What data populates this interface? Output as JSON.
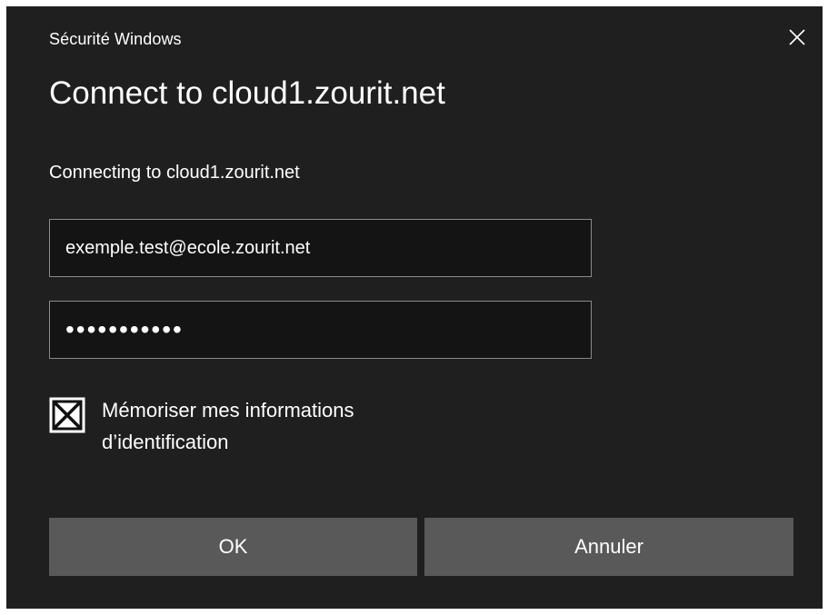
{
  "window": {
    "title": "Sécurité Windows",
    "close_icon": "close-icon"
  },
  "dialog": {
    "heading": "Connect to cloud1.zourit.net",
    "subtitle": "Connecting to cloud1.zourit.net",
    "username_value": "exemple.test@ecole.zourit.net",
    "password_value": "•••••••••••",
    "remember_label": "Mémoriser mes informations d’identification",
    "remember_checked": true,
    "ok_label": "OK",
    "cancel_label": "Annuler"
  },
  "colors": {
    "dialog_background": "#1f1f1f",
    "field_background": "#141414",
    "field_border": "#8a8a8a",
    "button_background": "#595959",
    "text": "#ffffff"
  }
}
